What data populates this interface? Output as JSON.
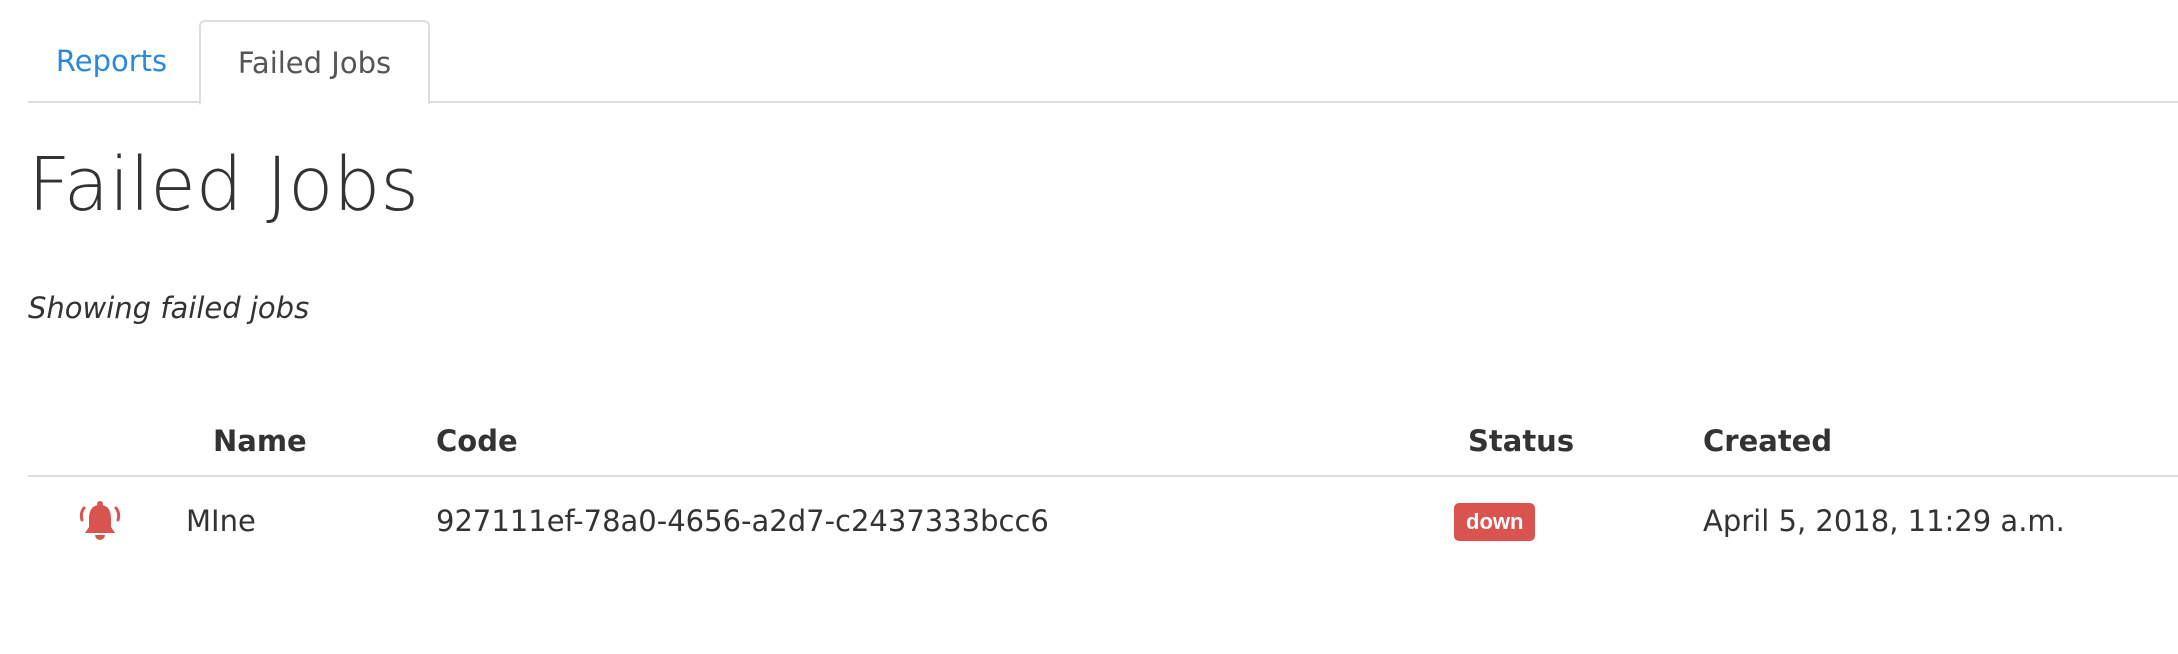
{
  "tabs": [
    {
      "label": "Reports",
      "active": false
    },
    {
      "label": "Failed Jobs",
      "active": true
    }
  ],
  "page": {
    "title": "Failed Jobs",
    "subtitle": "Showing failed jobs"
  },
  "table": {
    "headers": {
      "name": "Name",
      "code": "Code",
      "status": "Status",
      "created": "Created"
    },
    "rows": [
      {
        "icon": "bell-icon",
        "name": "MIne",
        "code": "927111ef-78a0-4656-a2d7-c2437333bcc6",
        "status": "down",
        "created": "April 5, 2018, 11:29 a.m."
      }
    ]
  },
  "colors": {
    "link": "#2a8ad9",
    "danger": "#d9534f",
    "border": "#dddddd",
    "text": "#333333"
  }
}
